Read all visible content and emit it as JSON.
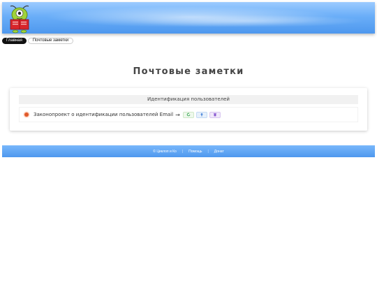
{
  "nav": {
    "items": [
      {
        "label": "Главная",
        "active": true
      },
      {
        "label": "Почтовые заметки",
        "active": false
      }
    ]
  },
  "page": {
    "title": "Почтовые заметки"
  },
  "card": {
    "header": "Идентификация пользователей",
    "row": {
      "text": "Законопроект о идентификации пользователей Email",
      "arrow": "→",
      "buttons": [
        {
          "icon": "refresh-icon",
          "color": "#3aa655"
        },
        {
          "icon": "upload-icon",
          "color": "#3b7bd6"
        },
        {
          "icon": "delete-icon",
          "color": "#8a5ad0"
        }
      ]
    }
  },
  "footer": {
    "copyright": "© Циклоп и Ко",
    "sep1": "|",
    "help": "Помощь",
    "sep2": "|",
    "donate": "Донат"
  },
  "colors": {
    "header_top": "#9ccbff",
    "header_bottom": "#4e98ee",
    "bullet": "#e05a2b"
  }
}
